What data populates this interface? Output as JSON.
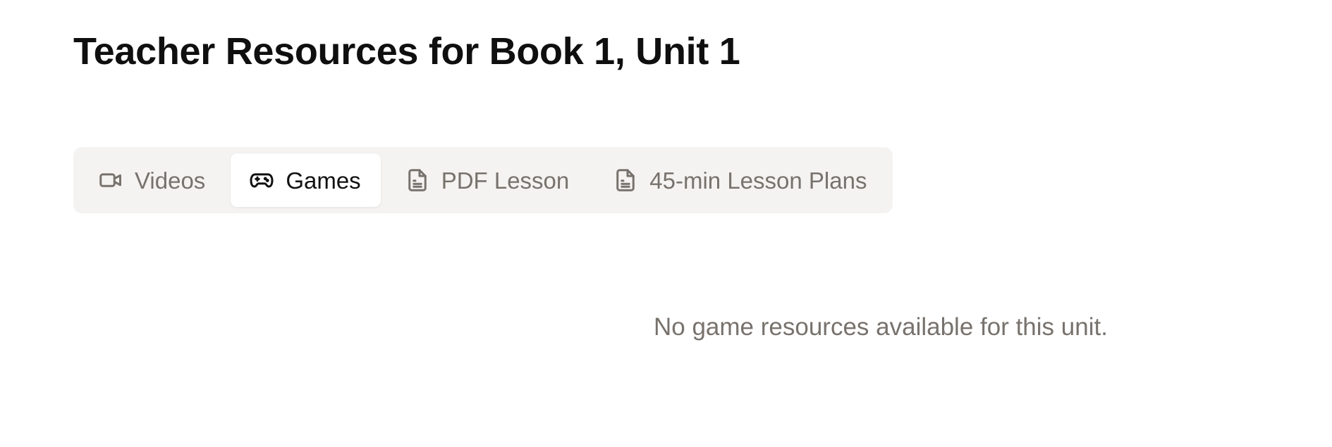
{
  "page": {
    "title": "Teacher Resources for Book 1, Unit 1"
  },
  "tabs": [
    {
      "label": "Videos",
      "icon": "video-icon",
      "active": false
    },
    {
      "label": "Games",
      "icon": "gamepad-icon",
      "active": true
    },
    {
      "label": "PDF Lesson",
      "icon": "document-icon",
      "active": false
    },
    {
      "label": "45-min Lesson Plans",
      "icon": "document-icon",
      "active": false
    }
  ],
  "content": {
    "empty_message": "No game resources available for this unit."
  },
  "colors": {
    "tab_bar_bg": "#f4f3f1",
    "active_tab_bg": "#ffffff",
    "inactive_text": "#78726d",
    "active_text": "#111111"
  }
}
